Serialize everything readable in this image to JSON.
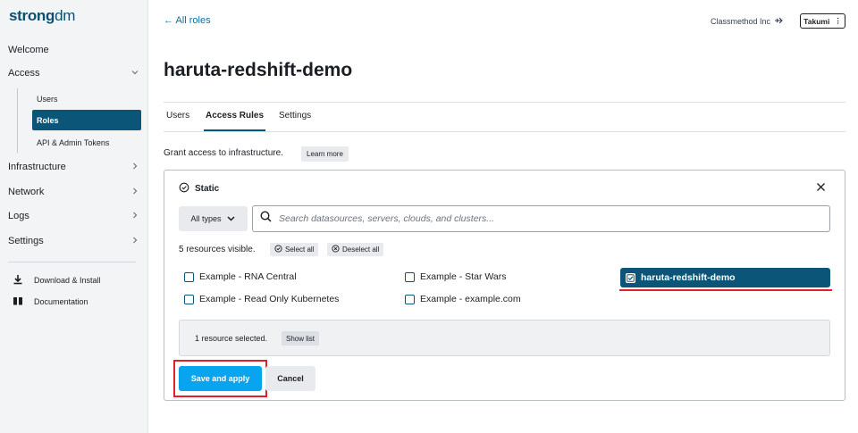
{
  "sidebar": {
    "logo_main": "strong",
    "logo_suffix": "dm",
    "items": [
      {
        "label": "Welcome"
      },
      {
        "label": "Access"
      },
      {
        "label": "Infrastructure"
      },
      {
        "label": "Network"
      },
      {
        "label": "Logs"
      },
      {
        "label": "Settings"
      }
    ],
    "access_sub": [
      {
        "label": "Users"
      },
      {
        "label": "Roles"
      },
      {
        "label": "API & Admin Tokens"
      }
    ],
    "links": [
      {
        "label": "Download & Install",
        "icon": "download-icon"
      },
      {
        "label": "Documentation",
        "icon": "book-icon"
      }
    ]
  },
  "header": {
    "back": "← All roles",
    "org": "Classmethod Inc",
    "user": "Takumi"
  },
  "page": {
    "title": "haruta-redshift-demo",
    "tabs": [
      {
        "label": "Users"
      },
      {
        "label": "Access Rules"
      },
      {
        "label": "Settings"
      }
    ],
    "grant_text": "Grant access to infrastructure.",
    "learn_more": "Learn more"
  },
  "panel": {
    "title": "Static",
    "types_label": "All types",
    "search_placeholder": "Search datasources, servers, clouds, and clusters...",
    "visible_text": "5 resources visible.",
    "select_all": "Select all",
    "deselect_all": "Deselect all",
    "resources": [
      {
        "label": "Example - RNA Central",
        "checked": false
      },
      {
        "label": "Example - Star Wars",
        "checked": false
      },
      {
        "label": "haruta-redshift-demo",
        "checked": true
      },
      {
        "label": "Example - Read Only Kubernetes",
        "checked": false
      },
      {
        "label": "Example - example.com",
        "checked": false
      }
    ],
    "selected_text": "1 resource selected.",
    "show_list": "Show list",
    "save": "Save and apply",
    "cancel": "Cancel"
  },
  "colors": {
    "accent": "#0b5678",
    "primary_button": "#08a4f0",
    "highlight": "#e0202a"
  }
}
